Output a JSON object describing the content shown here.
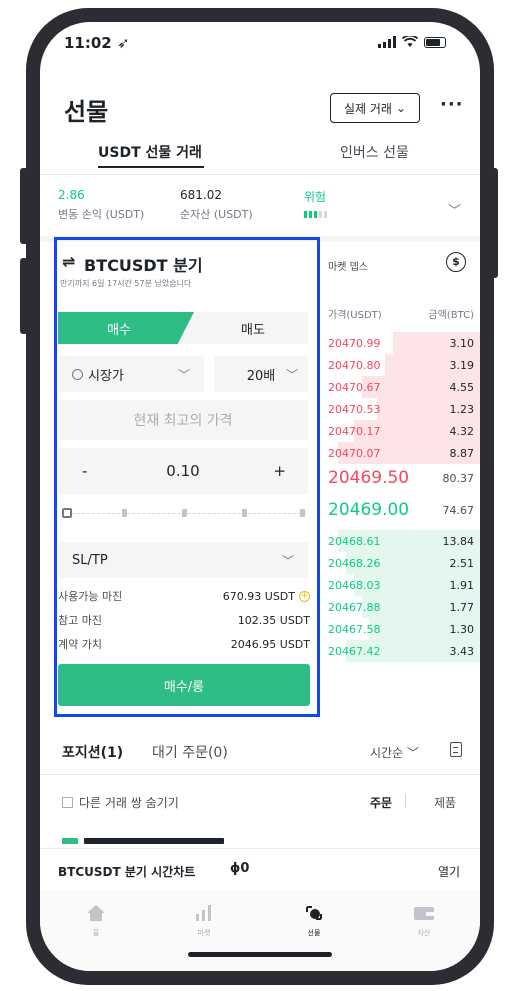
{
  "status_bar": {
    "time": "11:02 ➶"
  },
  "header": {
    "title": "선물",
    "mode_select": "실제 거래",
    "more": "···",
    "tabs": [
      {
        "label": "USDT 선물 거래"
      },
      {
        "label": "인버스 선물"
      }
    ]
  },
  "summary": {
    "pnl_value": "2.86",
    "pnl_label": "변동 손익 (USDT)",
    "equity_value": "681.02",
    "equity_label": "순자산 (USDT)",
    "risk_label": "위험",
    "risk_level": 0.6
  },
  "order_panel": {
    "pair_icon": "⇌",
    "pair": "BTCUSDT 분기",
    "pair_sub": "만기까지 6일 17시간 57분 남았습니다",
    "buy_tab": "매수",
    "sell_tab": "매도",
    "order_type": "시장가",
    "leverage": "20배",
    "price_placeholder": "현재 최고의 가격",
    "qty_minus": "-",
    "qty_value": "0.10",
    "qty_plus": "+",
    "sltp": "SL/TP",
    "available_margin_label": "사용가능 마진",
    "available_margin_value": "670.93 USDT",
    "ref_margin_label": "참고 마진",
    "ref_margin_value": "102.35 USDT",
    "contract_value_label": "계약 가치",
    "contract_value_value": "2046.95 USDT",
    "buy_button": "매수/롱"
  },
  "orderbook": {
    "mode_label": "마켓 뎁스",
    "coin_icon": "$",
    "price_header": "가격(USDT)",
    "amount_header": "금액(BTC)",
    "asks": [
      {
        "price": "20470.99",
        "amount": "3.10",
        "depth": 0.55
      },
      {
        "price": "20470.80",
        "amount": "3.19",
        "depth": 0.6
      },
      {
        "price": "20470.67",
        "amount": "4.55",
        "depth": 0.75
      },
      {
        "price": "20470.53",
        "amount": "1.23",
        "depth": 0.65
      },
      {
        "price": "20470.17",
        "amount": "4.32",
        "depth": 0.8
      },
      {
        "price": "20470.07",
        "amount": "8.87",
        "depth": 0.9
      }
    ],
    "mid_price": "20469.50",
    "mid_amount": "80.37",
    "bid_top_price": "20469.00",
    "bid_top_amount": "74.67",
    "bids": [
      {
        "price": "20468.61",
        "amount": "13.84",
        "depth": 0.9
      },
      {
        "price": "20468.26",
        "amount": "2.51",
        "depth": 0.85
      },
      {
        "price": "20468.03",
        "amount": "1.91",
        "depth": 0.8
      },
      {
        "price": "20467.88",
        "amount": "1.77",
        "depth": 0.75
      },
      {
        "price": "20467.58",
        "amount": "1.30",
        "depth": 0.7
      },
      {
        "price": "20467.42",
        "amount": "3.43",
        "depth": 0.85
      }
    ]
  },
  "positions": {
    "tab_positions": "포지션(1)",
    "tab_pending": "대기 주문(0)",
    "sort": "시간순 ﹀",
    "hide_other": "다른 거래 쌍 숨기기",
    "close_order": "주문",
    "close_market": "제품"
  },
  "ticker": {
    "pair": "BTCUSDT 분기",
    "chart_label": "시간차트",
    "chart_icon": "ɸ0",
    "open": "열기"
  },
  "nav": [
    {
      "label": "홈",
      "icon": "home-icon"
    },
    {
      "label": "마켓",
      "icon": "markets-icon"
    },
    {
      "label": "선물",
      "icon": "futures-icon"
    },
    {
      "label": "자산",
      "icon": "wallet-icon"
    }
  ],
  "colors": {
    "buy": "#2ebd85",
    "sell": "#f6465d",
    "highlight": "#1446f2"
  }
}
